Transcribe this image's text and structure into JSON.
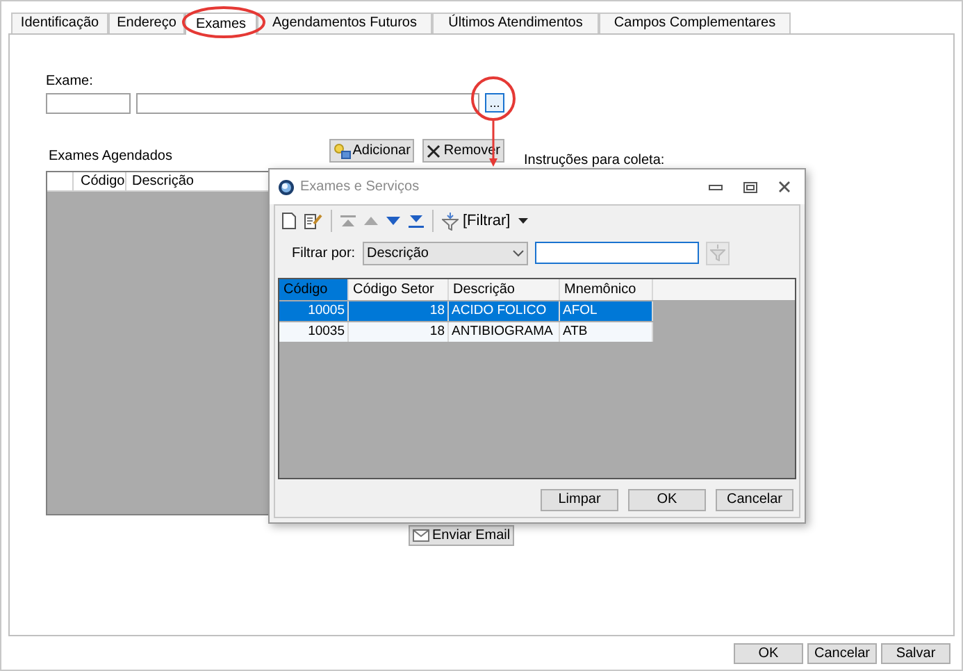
{
  "tabs": [
    {
      "label": "Identificação",
      "selected": false
    },
    {
      "label": "Endereço",
      "selected": false
    },
    {
      "label": "Exames",
      "selected": true
    },
    {
      "label": "Agendamentos Futuros",
      "selected": false
    },
    {
      "label": "Últimos Atendimentos",
      "selected": false
    },
    {
      "label": "Campos Complementares",
      "selected": false
    }
  ],
  "form": {
    "exam_label": "Exame:",
    "lookup_button": "...",
    "scheduled_label": "Exames Agendados",
    "add_button": "Adicionar",
    "remove_button": "Remover",
    "instructions_label": "Instruções para coleta:",
    "scheduled_columns": [
      "Código",
      "Descrição"
    ],
    "email_button": "Enviar Email"
  },
  "dialog": {
    "title": "Exames e Serviços",
    "filter_menu": "[Filtrar]",
    "filter_label": "Filtrar por:",
    "filter_field": "Descrição",
    "columns": [
      {
        "label": "Código",
        "selected": true
      },
      {
        "label": "Código Setor",
        "selected": false
      },
      {
        "label": "Descrição",
        "selected": false
      },
      {
        "label": "Mnemônico",
        "selected": false
      }
    ],
    "rows": [
      {
        "cells": [
          "10005",
          "18",
          "ACIDO FOLICO",
          "AFOL"
        ],
        "selected": true
      },
      {
        "cells": [
          "10035",
          "18",
          "ANTIBIOGRAMA",
          "ATB"
        ],
        "selected": false
      }
    ],
    "buttons": [
      "Limpar",
      "OK",
      "Cancelar"
    ]
  },
  "buttons": [
    "OK",
    "Cancelar",
    "Salvar"
  ]
}
